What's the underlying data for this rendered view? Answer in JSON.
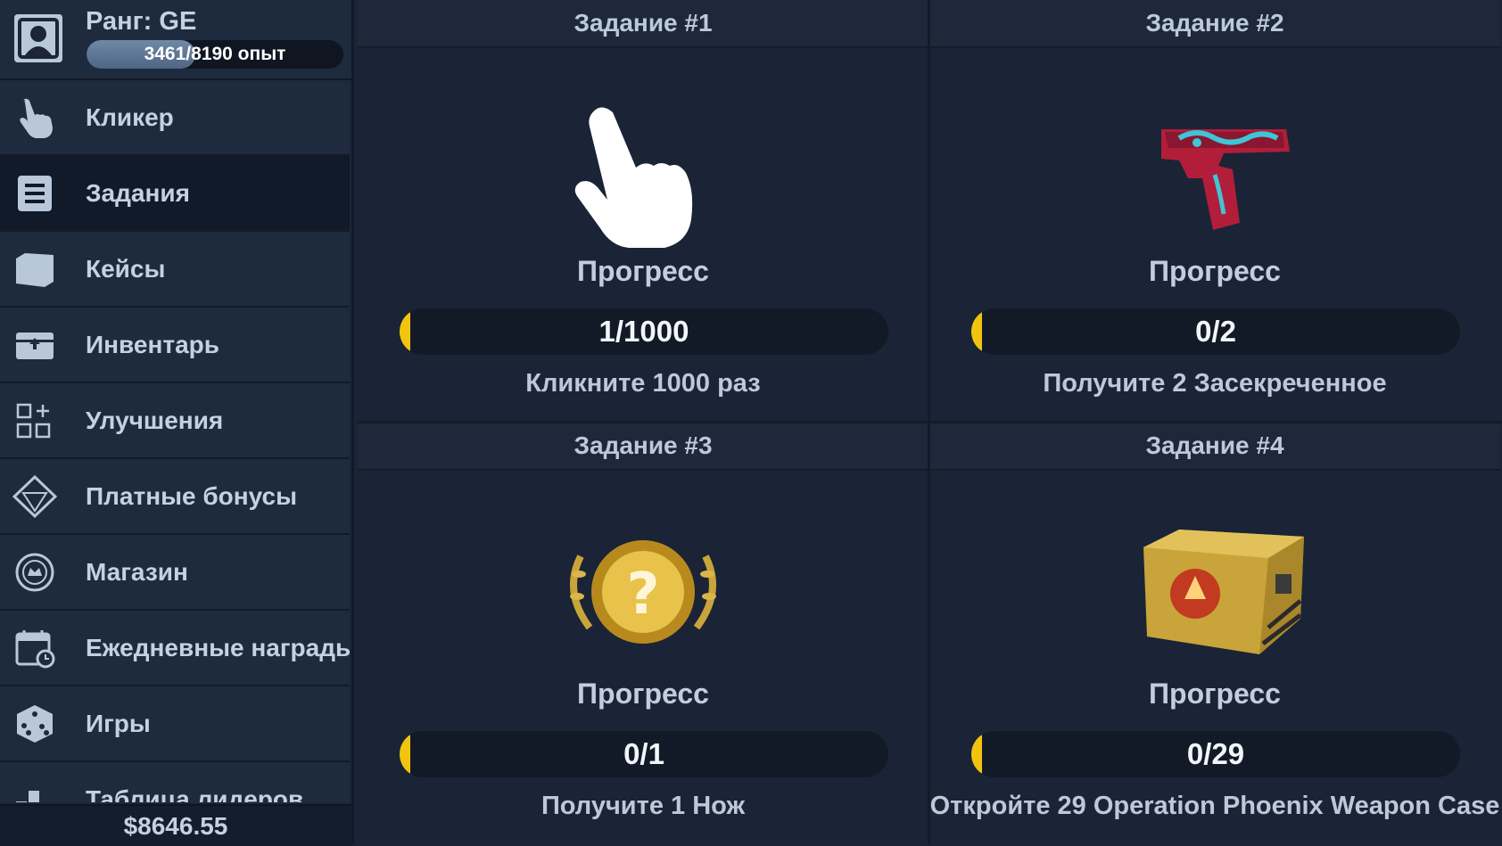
{
  "profile": {
    "rank": "Ранг: GE",
    "xp_text": "3461/8190 опыт",
    "xp_fraction": 0.4226
  },
  "nav": {
    "items": [
      {
        "label": "Кликер",
        "icon": "pointer-hand-icon"
      },
      {
        "label": "Задания",
        "icon": "list-scroll-icon",
        "active": true
      },
      {
        "label": "Кейсы",
        "icon": "case-icon"
      },
      {
        "label": "Инвентарь",
        "icon": "inventory-icon"
      },
      {
        "label": "Улучшения",
        "icon": "upgrades-grid-icon"
      },
      {
        "label": "Платные бонусы",
        "icon": "diamond-icon"
      },
      {
        "label": "Магазин",
        "icon": "shop-icon"
      },
      {
        "label": "Ежедневные награды",
        "icon": "calendar-icon"
      },
      {
        "label": "Игры",
        "icon": "dice-icon"
      },
      {
        "label": "Таблица лидеров",
        "icon": "leaderboard-icon"
      }
    ]
  },
  "balance": "$8646.55",
  "quests": [
    {
      "title": "Задание #1",
      "progress_label": "Прогресс",
      "progress_text": "1/1000",
      "progress_fraction": 0.001,
      "description": "Кликните 1000 раз",
      "icon": "pointer-hand-icon"
    },
    {
      "title": "Задание #2",
      "progress_label": "Прогресс",
      "progress_text": "0/2",
      "progress_fraction": 0,
      "description": "Получите 2 Засекреченное",
      "icon": "pistol-icon"
    },
    {
      "title": "Задание #3",
      "progress_label": "Прогресс",
      "progress_text": "0/1",
      "progress_fraction": 0,
      "description": "Получите 1 Нож",
      "icon": "mystery-medal-icon"
    },
    {
      "title": "Задание #4",
      "progress_label": "Прогресс",
      "progress_text": "0/29",
      "progress_fraction": 0,
      "description": "Откройте 29 Operation Phoenix Weapon Case",
      "icon": "weapon-case-icon"
    }
  ],
  "colors": {
    "background": "#1a2436",
    "panel": "#1e2a3d",
    "progress_accent": "#f1c40f",
    "text": "#c3d1e2"
  }
}
